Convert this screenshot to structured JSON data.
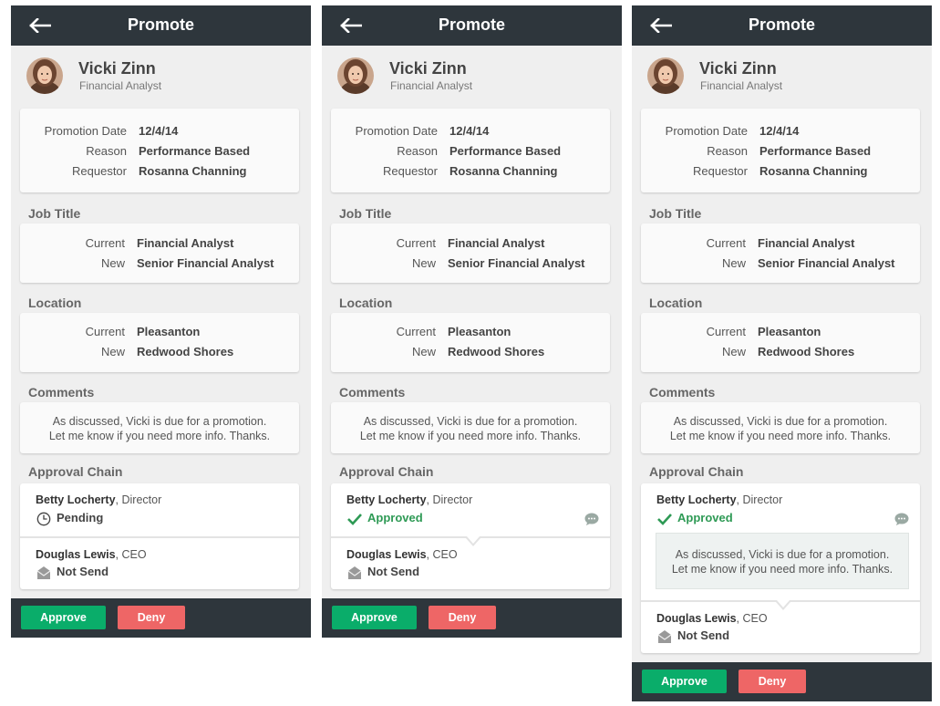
{
  "title": "Promote",
  "employee": {
    "name": "Vicki Zinn",
    "role": "Financial Analyst"
  },
  "details": {
    "promotion_date_label": "Promotion Date",
    "promotion_date": "12/4/14",
    "reason_label": "Reason",
    "reason": "Performance Based",
    "requestor_label": "Requestor",
    "requestor": "Rosanna Channing"
  },
  "job_title": {
    "heading": "Job Title",
    "current_label": "Current",
    "current": "Financial Analyst",
    "new_label": "New",
    "new": "Senior Financial Analyst"
  },
  "location": {
    "heading": "Location",
    "current_label": "Current",
    "current": "Pleasanton",
    "new_label": "New",
    "new": "Redwood Shores"
  },
  "comments": {
    "heading": "Comments",
    "line1": "As discussed, Vicki is due for a promotion.",
    "line2": "Let me know if you need more info. Thanks."
  },
  "approval_chain": {
    "heading": "Approval Chain",
    "approvers": [
      {
        "name": "Betty Locherty",
        "title": ", Director"
      },
      {
        "name": "Douglas Lewis",
        "title": ", CEO"
      }
    ],
    "status": {
      "pending": "Pending",
      "approved": "Approved",
      "not_send": "Not Send"
    }
  },
  "actions": {
    "approve": "Approve",
    "deny": "Deny"
  },
  "colors": {
    "bar": "#2e363c",
    "approve": "#0aad6a",
    "deny": "#ee6666",
    "approved_text": "#2e9a55"
  },
  "icons": {
    "back": "arrow-left-icon",
    "pending": "clock-icon",
    "approved": "check-icon",
    "not_send": "envelope-icon",
    "comment": "chat-bubble-icon"
  }
}
